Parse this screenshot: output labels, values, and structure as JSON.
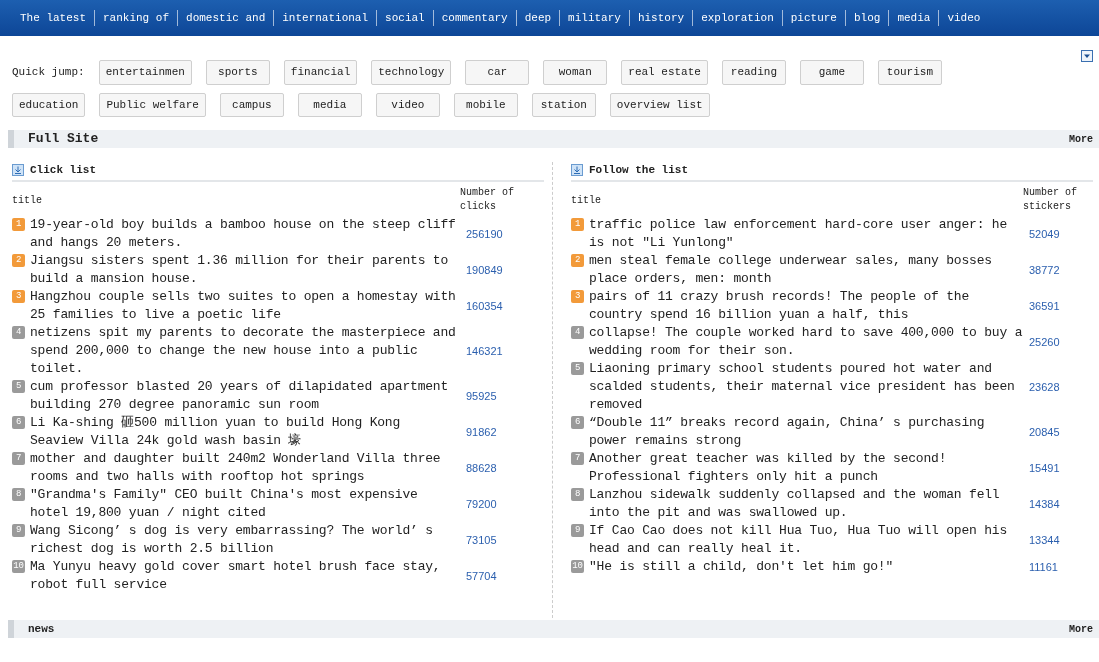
{
  "nav": [
    "The latest",
    "ranking of",
    "domestic and",
    "international",
    "social",
    "commentary",
    "deep",
    "military",
    "history",
    "exploration",
    "picture",
    "blog",
    "media",
    "video"
  ],
  "quick_jump": {
    "label": "Quick jump:",
    "links": [
      "entertainmen",
      "sports",
      "financial",
      "technology",
      "car",
      "woman",
      "real estate",
      "reading",
      "game",
      "tourism",
      "education",
      "Public welfare",
      "campus",
      "media",
      "video",
      "mobile",
      "station",
      "overview list"
    ]
  },
  "full_site": {
    "title": "Full Site",
    "more": "More"
  },
  "panels": [
    {
      "title": "Click list",
      "columns": [
        "title",
        "Number of clicks"
      ],
      "rows": [
        {
          "rank": "1",
          "highlighted": true,
          "title": "19-year-old boy builds a bamboo house on the steep cliff and hangs 20 meters.",
          "count": "256190"
        },
        {
          "rank": "2",
          "highlighted": true,
          "title": "Jiangsu sisters spent 1.36 million for their parents to build a mansion house.",
          "count": "190849"
        },
        {
          "rank": "3",
          "highlighted": true,
          "title": "Hangzhou couple sells two suites to open a homestay with 25 families to live a poetic life",
          "count": "160354"
        },
        {
          "rank": "4",
          "highlighted": false,
          "title": "netizens spit my parents to decorate the masterpiece and spend 200,000 to change the new house into a public toilet.",
          "count": "146321"
        },
        {
          "rank": "5",
          "highlighted": false,
          "title": "cum professor blasted 20 years of dilapidated apartment building 270 degree panoramic sun room",
          "count": "95925"
        },
        {
          "rank": "6",
          "highlighted": false,
          "title": "Li Ka-shing 砸500 million yuan to build Hong Kong Seaview Villa 24k gold wash basin 壕",
          "count": "91862"
        },
        {
          "rank": "7",
          "highlighted": false,
          "title": "mother and daughter built 240m2 Wonderland Villa three rooms and two halls with rooftop hot springs",
          "count": "88628"
        },
        {
          "rank": "8",
          "highlighted": false,
          "title": "\"Grandma's Family\" CEO built China's most expensive hotel 19,800 yuan / night cited",
          "count": "79200"
        },
        {
          "rank": "9",
          "highlighted": false,
          "title": "Wang Sicong’ s dog is very embarrassing? The world’ s richest dog is worth 2.5 billion",
          "count": "73105"
        },
        {
          "rank": "10",
          "highlighted": false,
          "title": "Ma Yunyu heavy gold cover smart hotel brush face stay, robot full service",
          "count": "57704"
        }
      ]
    },
    {
      "title": "Follow the list",
      "columns": [
        "title",
        "Number of stickers"
      ],
      "rows": [
        {
          "rank": "1",
          "highlighted": true,
          "title": "traffic police law enforcement hard-core user anger: he is not \"Li Yunlong\"",
          "count": "52049"
        },
        {
          "rank": "2",
          "highlighted": true,
          "title": "men steal female college underwear sales, many bosses place orders, men: month",
          "count": "38772"
        },
        {
          "rank": "3",
          "highlighted": true,
          "title": "pairs of 11 crazy brush records! The people of the country spend 16 billion yuan a half, this",
          "count": "36591"
        },
        {
          "rank": "4",
          "highlighted": false,
          "title": "collapse! The couple worked hard to save 400,000 to buy a wedding room for their son.",
          "count": "25260"
        },
        {
          "rank": "5",
          "highlighted": false,
          "title": "Liaoning primary school students poured hot water and scalded students, their maternal vice president has been removed",
          "count": "23628"
        },
        {
          "rank": "6",
          "highlighted": false,
          "title": "“Double 11” breaks record again, China’ s purchasing power remains strong",
          "count": "20845"
        },
        {
          "rank": "7",
          "highlighted": false,
          "title": "Another great teacher was killed by the second! Professional fighters only hit a punch",
          "count": "15491"
        },
        {
          "rank": "8",
          "highlighted": false,
          "title": "Lanzhou sidewalk suddenly collapsed and the woman fell into the pit and was swallowed up.",
          "count": "14384"
        },
        {
          "rank": "9",
          "highlighted": false,
          "title": "If Cao Cao does not kill Hua Tuo, Hua Tuo will open his head and can really heal it.",
          "count": "13344"
        },
        {
          "rank": "10",
          "highlighted": false,
          "title": "\"He is still a child, don't let him go!\"",
          "count": "11161"
        }
      ]
    }
  ],
  "news": {
    "title": "news",
    "more": "More"
  }
}
